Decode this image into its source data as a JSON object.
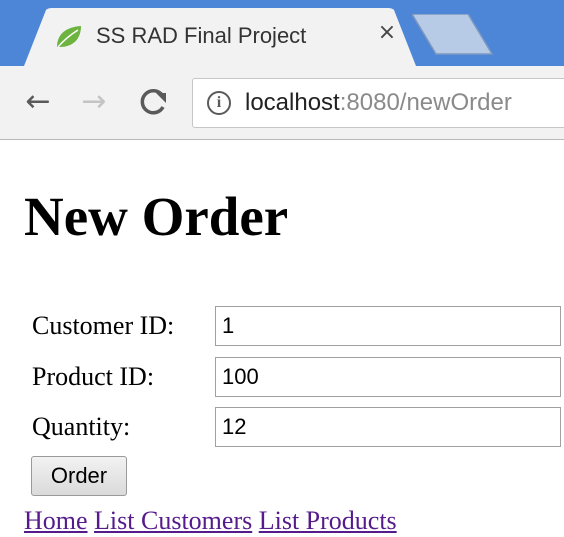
{
  "browser": {
    "tab_title": "SS RAD Final Project",
    "tab_close": "×",
    "url_host": "localhost",
    "url_rest": ":8080/newOrder",
    "info_glyph": "i",
    "icons": {
      "favicon": "spring-leaf-icon",
      "back": "back-arrow-icon",
      "forward": "forward-arrow-icon",
      "reload": "reload-icon",
      "info": "info-icon"
    },
    "colors": {
      "tabstrip": "#4d86d6",
      "toolbar": "#f2f2f2",
      "favicon": "#6db33f"
    }
  },
  "page": {
    "title": "New Order",
    "form": {
      "fields": [
        {
          "label": "Customer ID:",
          "value": "1"
        },
        {
          "label": "Product ID:",
          "value": "100"
        },
        {
          "label": "Quantity:",
          "value": "12"
        }
      ],
      "submit_label": "Order"
    },
    "links": [
      "Home",
      "List Customers",
      "List Products"
    ],
    "colors": {
      "visited_link": "#551a8b"
    }
  }
}
